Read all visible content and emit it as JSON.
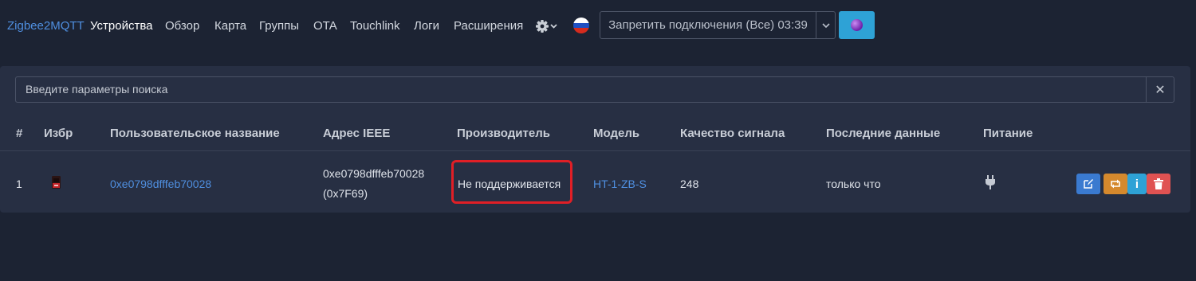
{
  "nav": {
    "brand": "Zigbee2MQTT",
    "links": [
      "Устройства",
      "Обзор",
      "Карта",
      "Группы",
      "OTA",
      "Touchlink",
      "Логи",
      "Расширения"
    ],
    "settings_icon": "gear-icon",
    "language_flag": "russia-flag-icon",
    "permit_join_label": "Запретить подключения (Все) 03:39",
    "theme_icon": "theme-orb-icon"
  },
  "search": {
    "placeholder": "Введите параметры поиска",
    "clear_icon": "close-icon"
  },
  "table": {
    "headers": [
      "#",
      "Избр",
      "Пользовательское название",
      "Адрес IEEE",
      "Производитель",
      "Модель",
      "Качество сигнала",
      "Последние данные",
      "Питание"
    ],
    "rows": [
      {
        "index": "1",
        "friendly_name": "0xe0798dfffeb70028",
        "ieee_line1": "0xe0798dfffeb70028",
        "ieee_line2": "(0x7F69)",
        "manufacturer": "Не поддерживается",
        "model": "HT-1-ZB-S",
        "lqi": "248",
        "last_seen": "только что",
        "power_icon": "plug-icon",
        "actions": [
          "edit-icon",
          "reconfigure-icon",
          "info-icon",
          "delete-icon"
        ]
      }
    ]
  },
  "colors": {
    "background": "#1c2333",
    "card": "#272f43",
    "link": "#4f8fe0",
    "highlight_border": "#e01f26",
    "edit": "#3a7ad0",
    "reconfigure": "#d5892d",
    "info": "#2ea2d6",
    "delete": "#e05252"
  }
}
